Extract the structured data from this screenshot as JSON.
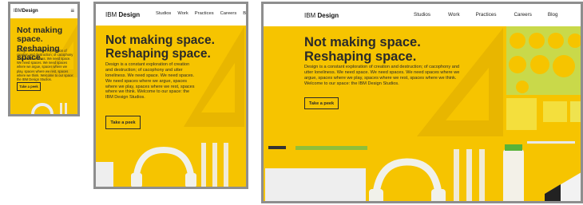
{
  "brand": {
    "prefix": "IBM",
    "name": "Design"
  },
  "nav_items": [
    "Studios",
    "Work",
    "Practices",
    "Careers",
    "Blog"
  ],
  "menu_icon": "hamburger-icon",
  "headline_line1": "Not making space.",
  "headline_line2": "Reshaping space.",
  "body_text": "Design is a constant exploration of creation and destruction; of cacophony and utter loneliness. We need space. We need spaces. We need spaces where we argue, spaces where we play, spaces where we rest, spaces where we think. Welcome to our space: the IBM Design Studios.",
  "cta_label": "Take a peek",
  "colors": {
    "background": "#f6c400",
    "frame_border": "#8e8e8e",
    "text": "#2a2a2a"
  }
}
